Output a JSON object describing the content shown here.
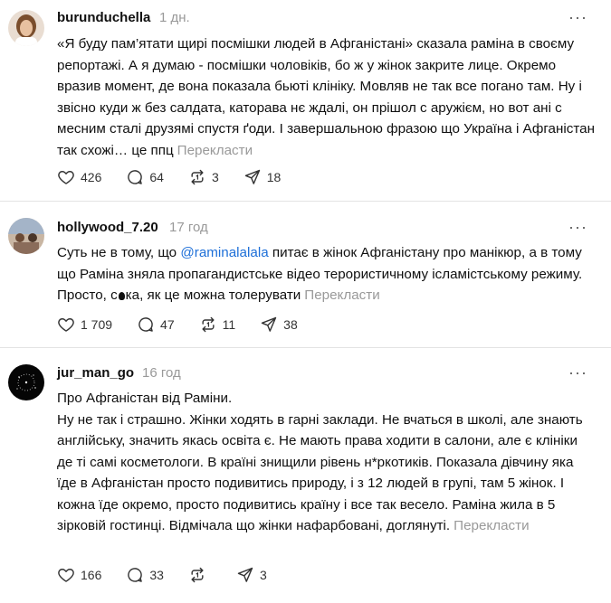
{
  "posts": [
    {
      "username": "burunduchella",
      "time": "1 дн.",
      "text": "«Я буду пам’ятати щирі посмішки людей в Афганістані» сказала раміна в своєму репортажі. А я думаю - посмішки чоловіків, бо ж у жінок закрите лице. Окремо вразив момент, де вона показала бьюті клініку. Мовляв не так все погано там. Ну і звісно куди ж без салдата, каторава нє ждалі, он прішол с аружієм, но вот ані с месним сталі друзямі спустя ґоди. І завершальною фразою що Україна і Афганістан так схожі… це ппц",
      "translate": "Перекласти",
      "likes": "426",
      "comments": "64",
      "reposts": "3",
      "shares": "18"
    },
    {
      "username": "hollywood_7.20",
      "time": "17 год",
      "text_before": "Суть не в тому, що ",
      "mention": "@raminalalala",
      "text_after": " питає в жінок Афганістану про манікюр, а в тому що Раміна зняла пропагандистське відео терористичному ісламістському режиму. Просто, с",
      "text_end": "ка, як це можна толерувати",
      "translate": "Перекласти",
      "likes": "1 709",
      "comments": "47",
      "reposts": "11",
      "shares": "38"
    },
    {
      "username": "jur_man_go",
      "time": "16 год",
      "line1": "Про Афганістан від Раміни.",
      "text": "Ну не так і страшно. Жінки ходять в гарні заклади. Не вчаться в школі, але знають англійську, значить якась освіта є. Не мають права ходити в салони, але є клініки де ті самі косметологи. В країні знищили рівень н*ркотиків. Показала дівчину яка їде в Афганістан просто подивитись природу, і з 12 людей в групі, там 5 жінок. І кожна їде окремо, просто подивитись країну і все так весело. Раміна жила в 5 зірковій гостинці. Відмічала що жінки нафарбовані, доглянуті.",
      "translate": "Перекласти",
      "likes": "166",
      "comments": "33",
      "reposts": "",
      "shares": "3"
    }
  ],
  "icons": [
    "heart-icon",
    "comment-icon",
    "repost-icon",
    "share-icon",
    "more-icon"
  ],
  "colors": {
    "text": "#101010",
    "muted": "#999999",
    "mention": "#1d6fd8",
    "divider": "#e3e3e3"
  }
}
